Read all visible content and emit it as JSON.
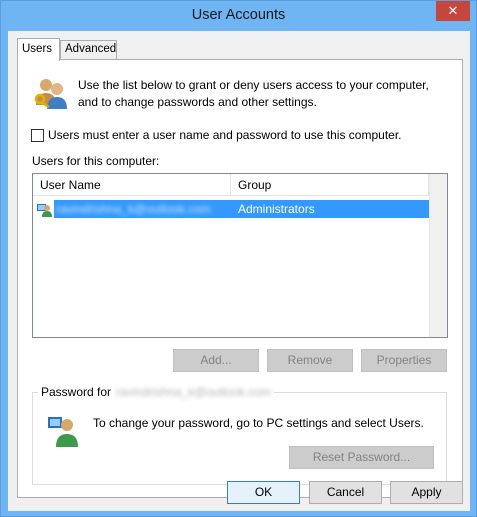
{
  "window": {
    "title": "User Accounts",
    "close_glyph": "✕"
  },
  "tabs": [
    {
      "label": "Users",
      "active": true
    },
    {
      "label": "Advanced",
      "active": false
    }
  ],
  "users_tab": {
    "intro_line1": "Use the list below to grant or deny users access to your computer,",
    "intro_line2": "and to change passwords and other settings.",
    "require_login_label": "Users must enter a user name and password to use this computer.",
    "require_login_checked": false,
    "users_list_label": "Users for this computer:",
    "columns": [
      "User Name",
      "Group"
    ],
    "rows": [
      {
        "user_name": "ravindrishna_k@outlook.com",
        "group": "Administrators",
        "selected": true
      }
    ],
    "buttons": {
      "add": "Add...",
      "remove": "Remove",
      "properties": "Properties"
    },
    "password_group": {
      "legend": "Password for",
      "user": "ravindrishna_k@outlook.com",
      "message": "To change your password, go to PC settings and select Users.",
      "reset_button": "Reset Password..."
    }
  },
  "footer": {
    "ok": "OK",
    "cancel": "Cancel",
    "apply": "Apply"
  },
  "colors": {
    "title_bar": "#6fb4f3",
    "selection": "#3399ff",
    "close_button": "#c7463c"
  }
}
